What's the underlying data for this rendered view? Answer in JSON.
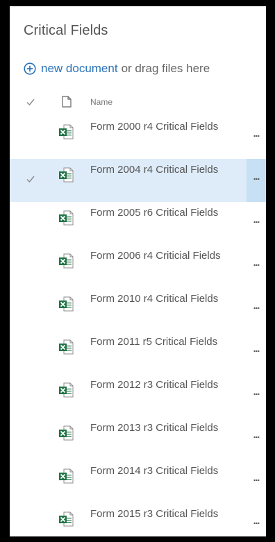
{
  "library": {
    "title": "Critical Fields",
    "new_document_link": "new document",
    "new_document_suffix": "or drag files here"
  },
  "columns": {
    "name": "Name"
  },
  "icons": {
    "add": "plus-circle-icon",
    "select_all": "checkmark-icon",
    "file_type_header": "document-icon",
    "file": "excel-file-icon",
    "more": "ellipsis-icon"
  },
  "colors": {
    "link": "#2a73b8",
    "selected_row": "#deecf9",
    "selected_more": "#c7e0f4",
    "excel_green": "#217346"
  },
  "files": [
    {
      "name": "Form 2000 r4 Critical Fields",
      "selected": false,
      "more": "..."
    },
    {
      "name": "Form 2004 r4 Critical Fields",
      "selected": true,
      "more": "..."
    },
    {
      "name": "Form 2005 r6 Critical Fields",
      "selected": false,
      "more": "..."
    },
    {
      "name": "Form 2006 r4 Criticial Fields",
      "selected": false,
      "more": "..."
    },
    {
      "name": "Form 2010 r4 Critical Fields",
      "selected": false,
      "more": "..."
    },
    {
      "name": "Form 2011 r5 Critical Fields",
      "selected": false,
      "more": "..."
    },
    {
      "name": "Form 2012 r3 Critical Fields",
      "selected": false,
      "more": "..."
    },
    {
      "name": "Form 2013 r3 Critical Fields",
      "selected": false,
      "more": "..."
    },
    {
      "name": "Form 2014 r3 Critical Fields",
      "selected": false,
      "more": "..."
    },
    {
      "name": "Form 2015 r3 Critical Fields",
      "selected": false,
      "more": "..."
    }
  ]
}
